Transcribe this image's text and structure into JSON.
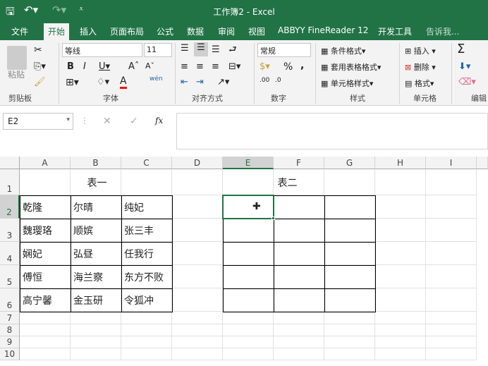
{
  "title": "工作簿2 - Excel",
  "quick_access": {
    "save_icon": "save-icon",
    "undo_icon": "undo-icon",
    "redo_icon": "redo-icon"
  },
  "tabs": [
    "文件",
    "开始",
    "插入",
    "页面布局",
    "公式",
    "数据",
    "审阅",
    "视图",
    "ABBYY FineReader 12",
    "开发工具",
    "告诉我..."
  ],
  "active_tab": "开始",
  "ribbon": {
    "clipboard": {
      "label": "剪贴板",
      "paste": "粘贴"
    },
    "font": {
      "label": "字体",
      "name": "等线",
      "size": "11",
      "wen": "wén"
    },
    "align": {
      "label": "对齐方式"
    },
    "number": {
      "label": "数字",
      "format": "常规",
      "percent": "%",
      "comma": ",",
      "inc": ".00",
      "dec": ".0"
    },
    "styles": {
      "label": "样式",
      "cond": "条件格式",
      "table": "套用表格格式",
      "cell": "单元格样式"
    },
    "cells": {
      "label": "单元格",
      "insert": "插入",
      "delete": "删除",
      "format": "格式"
    },
    "edit": {
      "label": "编辑",
      "sum": "Σ"
    }
  },
  "formula_bar": {
    "name_box": "E2",
    "fx": "fx",
    "value": ""
  },
  "columns": [
    "A",
    "B",
    "C",
    "D",
    "E",
    "F",
    "G",
    "H",
    "I"
  ],
  "selected_cell": "E2",
  "rows": [
    "1",
    "2",
    "3",
    "4",
    "5",
    "6",
    "7",
    "8",
    "9",
    "10"
  ],
  "table1": {
    "title": "表一",
    "data": [
      [
        "乾隆",
        "尔晴",
        "纯妃"
      ],
      [
        "魏璎珞",
        "顺嫔",
        "张三丰"
      ],
      [
        "娴妃",
        "弘昼",
        "任我行"
      ],
      [
        "傅恒",
        "海兰察",
        "东方不败"
      ],
      [
        "高宁馨",
        "金玉研",
        "令狐冲"
      ]
    ]
  },
  "table2": {
    "title": "表二"
  },
  "colors": {
    "brand": "#217346",
    "font_color": "#ff0000"
  }
}
